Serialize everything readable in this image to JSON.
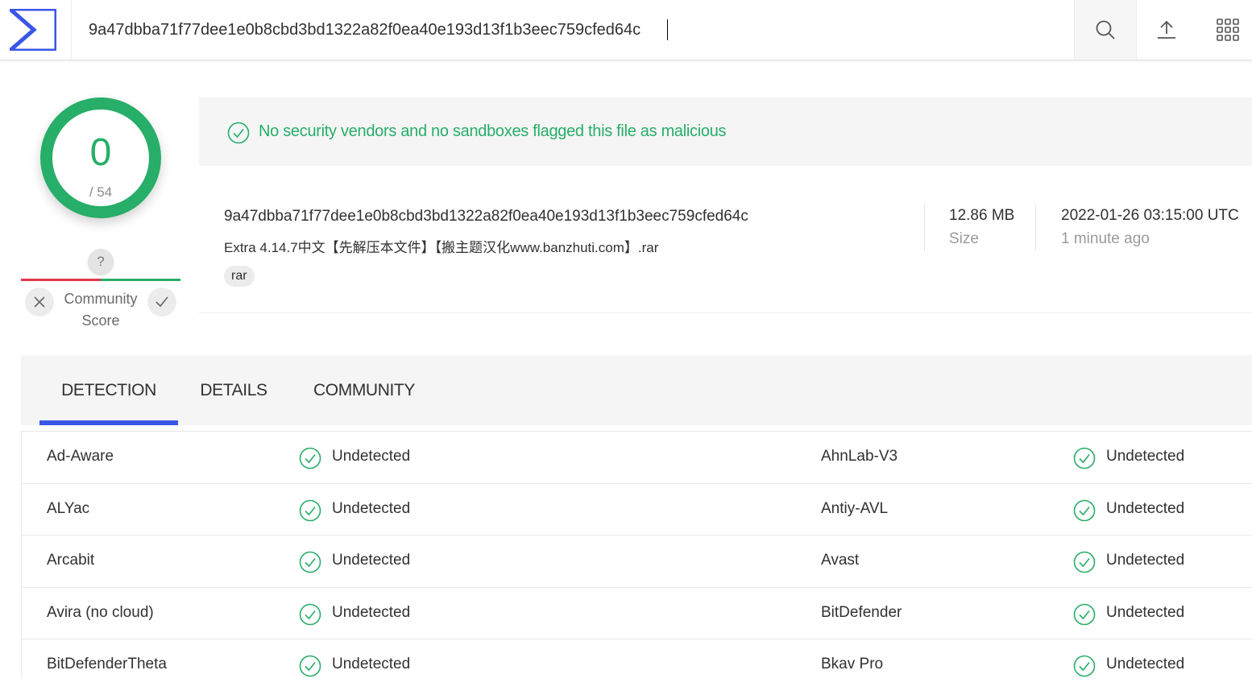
{
  "header": {
    "search_value": "9a47dbba71f77dee1e0b8cbd3bd1322a82f0ea40e193d13f1b3eec759cfed64c",
    "icons": [
      "sigma-logo-icon",
      "search-icon",
      "upload-icon",
      "apps-grid-icon"
    ]
  },
  "score": {
    "detections": "0",
    "total": "/ 54",
    "community_badge": "?",
    "community_label_line1": "Community",
    "community_label_line2": "Score"
  },
  "banner": {
    "text": "No security vendors and no sandboxes flagged this file as malicious"
  },
  "file": {
    "hash": "9a47dbba71f77dee1e0b8cbd3bd1322a82f0ea40e193d13f1b3eec759cfed64c",
    "name": "Extra 4.14.7中文【先解压本文件】【搬主题汉化www.banzhuti.com】.rar",
    "tag": "rar",
    "size_value": "12.86 MB",
    "size_label": "Size",
    "date_value": "2022-01-26 03:15:00 UTC",
    "date_ago": "1 minute ago"
  },
  "tabs": {
    "detection": "DETECTION",
    "details": "DETAILS",
    "community": "COMMUNITY",
    "active": "detection"
  },
  "colors": {
    "accent_green": "#27ae68",
    "accent_blue": "#3a56e6",
    "red": "#e2384b"
  },
  "detections": [
    {
      "left_vendor": "Ad-Aware",
      "left_result": "Undetected",
      "right_vendor": "AhnLab-V3",
      "right_result": "Undetected"
    },
    {
      "left_vendor": "ALYac",
      "left_result": "Undetected",
      "right_vendor": "Antiy-AVL",
      "right_result": "Undetected"
    },
    {
      "left_vendor": "Arcabit",
      "left_result": "Undetected",
      "right_vendor": "Avast",
      "right_result": "Undetected"
    },
    {
      "left_vendor": "Avira (no cloud)",
      "left_result": "Undetected",
      "right_vendor": "BitDefender",
      "right_result": "Undetected"
    },
    {
      "left_vendor": "BitDefenderTheta",
      "left_result": "Undetected",
      "right_vendor": "Bkav Pro",
      "right_result": "Undetected"
    }
  ]
}
